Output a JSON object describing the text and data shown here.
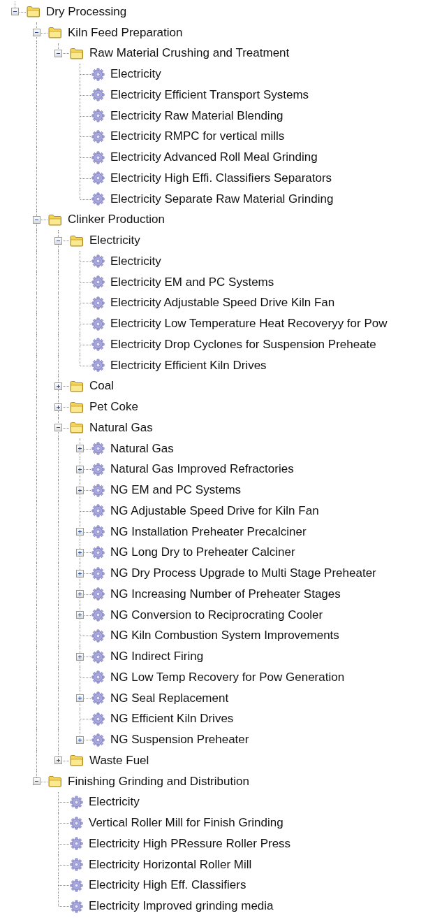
{
  "tree": [
    {
      "kind": "folder",
      "label": "Dry Processing",
      "expanded": true,
      "children": [
        {
          "kind": "folder",
          "label": "Kiln Feed Preparation",
          "expanded": true,
          "children": [
            {
              "kind": "folder",
              "label": "Raw Material Crushing and Treatment",
              "expanded": true,
              "children": [
                {
                  "kind": "item",
                  "label": "Electricity"
                },
                {
                  "kind": "item",
                  "label": "Electricity Efficient Transport Systems"
                },
                {
                  "kind": "item",
                  "label": "Electricity Raw Material Blending"
                },
                {
                  "kind": "item",
                  "label": "Electricity RMPC for vertical mills"
                },
                {
                  "kind": "item",
                  "label": "Electricity Advanced Roll Meal Grinding"
                },
                {
                  "kind": "item",
                  "label": "Electricity High Effi. Classifiers Separators"
                },
                {
                  "kind": "item",
                  "label": "Electricity Separate Raw Material Grinding"
                }
              ]
            }
          ]
        },
        {
          "kind": "folder",
          "label": "Clinker Production",
          "expanded": true,
          "children": [
            {
              "kind": "folder",
              "label": "Electricity",
              "expanded": true,
              "children": [
                {
                  "kind": "item",
                  "label": "Electricity"
                },
                {
                  "kind": "item",
                  "label": "Electricity EM and PC Systems"
                },
                {
                  "kind": "item",
                  "label": "Electricity Adjustable Speed Drive Kiln Fan"
                },
                {
                  "kind": "item",
                  "label": "Electricity Low Temperature Heat Recoveryy for Pow"
                },
                {
                  "kind": "item",
                  "label": "Electricity Drop Cyclones for Suspension Preheate"
                },
                {
                  "kind": "item",
                  "label": "Electricity Efficient Kiln Drives"
                }
              ]
            },
            {
              "kind": "folder",
              "label": "Coal",
              "expanded": false
            },
            {
              "kind": "folder",
              "label": "Pet Coke",
              "expanded": false
            },
            {
              "kind": "folder",
              "label": "Natural Gas",
              "expanded": true,
              "children": [
                {
                  "kind": "item",
                  "label": "Natural Gas",
                  "expanded": false
                },
                {
                  "kind": "item",
                  "label": "Natural Gas Improved Refractories",
                  "expanded": false
                },
                {
                  "kind": "item",
                  "label": "NG EM and PC Systems",
                  "expanded": false
                },
                {
                  "kind": "item",
                  "label": "NG Adjustable Speed Drive for Kiln Fan"
                },
                {
                  "kind": "item",
                  "label": "NG Installation Preheater Precalciner",
                  "expanded": false
                },
                {
                  "kind": "item",
                  "label": "NG Long Dry to Preheater Calciner",
                  "expanded": false
                },
                {
                  "kind": "item",
                  "label": "NG Dry Process Upgrade to Multi Stage Preheater",
                  "expanded": false
                },
                {
                  "kind": "item",
                  "label": "NG Increasing Number of Preheater Stages",
                  "expanded": false
                },
                {
                  "kind": "item",
                  "label": "NG Conversion to Reciprocrating Cooler",
                  "expanded": false
                },
                {
                  "kind": "item",
                  "label": "NG Kiln Combustion System Improvements"
                },
                {
                  "kind": "item",
                  "label": "NG Indirect Firing",
                  "expanded": false
                },
                {
                  "kind": "item",
                  "label": "NG Low Temp Recovery for Pow Generation"
                },
                {
                  "kind": "item",
                  "label": "NG Seal Replacement",
                  "expanded": false
                },
                {
                  "kind": "item",
                  "label": "NG Efficient Kiln Drives"
                },
                {
                  "kind": "item",
                  "label": "NG Suspension Preheater",
                  "expanded": false
                }
              ]
            },
            {
              "kind": "folder",
              "label": "Waste Fuel",
              "expanded": false
            }
          ]
        },
        {
          "kind": "folder",
          "label": "Finishing Grinding and Distribution",
          "expanded": true,
          "children": [
            {
              "kind": "item",
              "label": "Electricity"
            },
            {
              "kind": "item",
              "label": "Vertical Roller Mill for Finish Grinding"
            },
            {
              "kind": "item",
              "label": "Electricity High PRessure Roller Press"
            },
            {
              "kind": "item",
              "label": "Electricity Horizontal Roller Mill"
            },
            {
              "kind": "item",
              "label": "Electricity High Eff. Classifiers"
            },
            {
              "kind": "item",
              "label": "Electricity Improved grinding media"
            }
          ]
        }
      ]
    }
  ]
}
